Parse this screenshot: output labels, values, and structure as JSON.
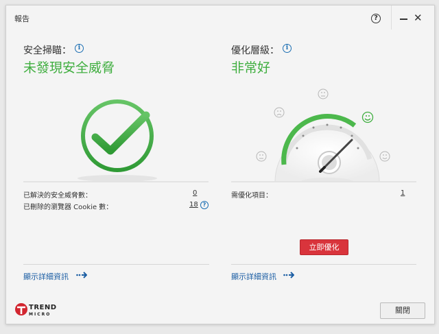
{
  "window": {
    "title": "報告"
  },
  "left": {
    "label": "安全掃瞄：",
    "status": "未發現安全威脅",
    "rows": [
      {
        "label": "已解決的安全威脅數：",
        "value": "0"
      },
      {
        "label": "已刪除的瀏覽器 Cookie 數：",
        "value": "18"
      }
    ],
    "link": "顯示詳細資訊"
  },
  "right": {
    "label": "優化層級：",
    "status": "非常好",
    "rows": [
      {
        "label": "需優化項目：",
        "value": "1"
      }
    ],
    "optimize_button": "立即優化",
    "link": "顯示詳細資訊"
  },
  "footer": {
    "close_button": "關閉",
    "logo_line1": "TREND",
    "logo_line2": "MICRO"
  },
  "colors": {
    "accent_green": "#3fae3f",
    "link_blue": "#1a5da3",
    "danger_red": "#d9343c"
  },
  "gauge": {
    "level": "very-good"
  },
  "icons": [
    "help-icon",
    "minimize-icon",
    "close-icon",
    "info-icon",
    "checkmark-icon",
    "gauge-icon",
    "arrow-right-icon",
    "trendmicro-logo"
  ]
}
